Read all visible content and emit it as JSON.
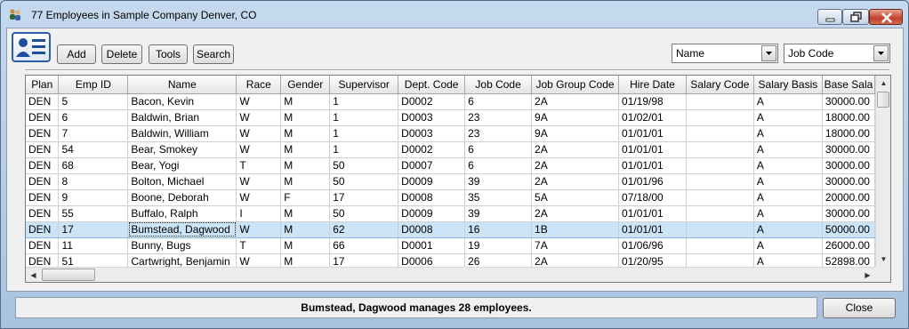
{
  "window": {
    "title": "77 Employees in Sample Company Denver, CO"
  },
  "toolbar": {
    "add_label": "Add",
    "delete_label": "Delete",
    "tools_label": "Tools",
    "search_label": "Search"
  },
  "sort": {
    "primary_value": "Name",
    "secondary_value": "Job Code"
  },
  "grid": {
    "columns": [
      "Plan",
      "Emp ID",
      "Name",
      "Race",
      "Gender",
      "Supervisor",
      "Dept. Code",
      "Job Code",
      "Job Group Code",
      "Hire Date",
      "Salary Code",
      "Salary Basis",
      "Base Sala"
    ],
    "rows": [
      [
        "DEN",
        "5",
        "Bacon, Kevin",
        "W",
        "M",
        "1",
        "D0002",
        "6",
        "2A",
        "01/19/98",
        "",
        "A",
        "30000.00"
      ],
      [
        "DEN",
        "6",
        "Baldwin, Brian",
        "W",
        "M",
        "1",
        "D0003",
        "23",
        "9A",
        "01/02/01",
        "",
        "A",
        "18000.00"
      ],
      [
        "DEN",
        "7",
        "Baldwin, William",
        "W",
        "M",
        "1",
        "D0003",
        "23",
        "9A",
        "01/01/01",
        "",
        "A",
        "18000.00"
      ],
      [
        "DEN",
        "54",
        "Bear, Smokey",
        "W",
        "M",
        "1",
        "D0002",
        "6",
        "2A",
        "01/01/01",
        "",
        "A",
        "30000.00"
      ],
      [
        "DEN",
        "68",
        "Bear, Yogi",
        "T",
        "M",
        "50",
        "D0007",
        "6",
        "2A",
        "01/01/01",
        "",
        "A",
        "30000.00"
      ],
      [
        "DEN",
        "8",
        "Bolton, Michael",
        "W",
        "M",
        "50",
        "D0009",
        "39",
        "2A",
        "01/01/96",
        "",
        "A",
        "30000.00"
      ],
      [
        "DEN",
        "9",
        "Boone, Deborah",
        "W",
        "F",
        "17",
        "D0008",
        "35",
        "5A",
        "07/18/00",
        "",
        "A",
        "20000.00"
      ],
      [
        "DEN",
        "55",
        "Buffalo, Ralph",
        "I",
        "M",
        "50",
        "D0009",
        "39",
        "2A",
        "01/01/01",
        "",
        "A",
        "30000.00"
      ],
      [
        "DEN",
        "17",
        "Bumstead, Dagwood",
        "W",
        "M",
        "62",
        "D0008",
        "16",
        "1B",
        "01/01/01",
        "",
        "A",
        "50000.00"
      ],
      [
        "DEN",
        "11",
        "Bunny, Bugs",
        "T",
        "M",
        "66",
        "D0001",
        "19",
        "7A",
        "01/06/96",
        "",
        "A",
        "26000.00"
      ],
      [
        "DEN",
        "51",
        "Cartwright, Benjamin",
        "W",
        "M",
        "17",
        "D0006",
        "26",
        "2A",
        "01/20/95",
        "",
        "A",
        "52898.00"
      ]
    ],
    "selected_row": 8
  },
  "status": {
    "message": "Bumstead, Dagwood manages 28 employees."
  },
  "footer": {
    "close_label": "Close"
  },
  "colors": {
    "selection": "#cce4f7",
    "window_frame": "#b9d1ea"
  }
}
